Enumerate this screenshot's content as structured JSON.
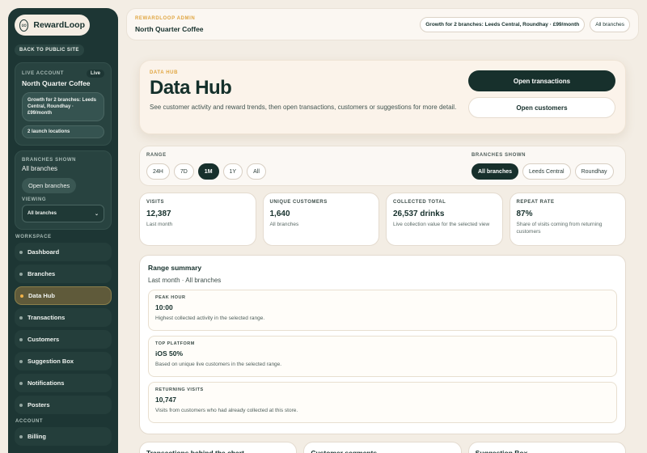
{
  "brand": {
    "name": "RewardLoop",
    "logo_icon": "loop-icon"
  },
  "sidebar": {
    "back_label": "Back to public site",
    "live_account": {
      "eyebrow": "Live account",
      "badge": "Live",
      "name": "North Quarter Coffee",
      "plan": "Growth for 2 branches: Leeds Central, Roundhay · £99/month",
      "locations": "2 launch locations"
    },
    "branches": {
      "eyebrow": "Branches shown",
      "value": "All branches",
      "open_label": "Open branches",
      "viewing_label": "Viewing",
      "viewing_value": "All branches"
    },
    "workspace_label": "Workspace",
    "nav": [
      {
        "label": "Dashboard",
        "active": false
      },
      {
        "label": "Branches",
        "active": false
      },
      {
        "label": "Data Hub",
        "active": true
      },
      {
        "label": "Transactions",
        "active": false
      },
      {
        "label": "Customers",
        "active": false
      },
      {
        "label": "Suggestion Box",
        "active": false
      },
      {
        "label": "Notifications",
        "active": false
      },
      {
        "label": "Posters",
        "active": false
      }
    ],
    "account_label": "Account",
    "account_nav": [
      {
        "label": "Billing"
      }
    ]
  },
  "topbar": {
    "eyebrow": "RewardLoop admin",
    "title": "North Quarter Coffee",
    "plan_pill": "Growth for 2 branches: Leeds Central, Roundhay · £99/month",
    "branch_pill": "All branches"
  },
  "hero": {
    "eyebrow": "Data Hub",
    "title": "Data Hub",
    "description": "See customer activity and reward trends, then open transactions, customers or suggestions for more detail.",
    "primary_button": "Open transactions",
    "secondary_button": "Open customers"
  },
  "filters": {
    "range_label": "Range",
    "ranges": [
      "24H",
      "7D",
      "1M",
      "1Y",
      "All"
    ],
    "active_range": "1M",
    "branches_label": "Branches shown",
    "branches": [
      "All branches",
      "Leeds Central",
      "Roundhay"
    ],
    "active_branch": "All branches"
  },
  "stats": [
    {
      "label": "Visits",
      "value": "12,387",
      "note": "Last month"
    },
    {
      "label": "Unique customers",
      "value": "1,640",
      "note": "All branches"
    },
    {
      "label": "Collected total",
      "value": "26,537 drinks",
      "note": "Live collection value for the selected view"
    },
    {
      "label": "Repeat rate",
      "value": "87%",
      "note": "Share of visits coming from returning customers"
    }
  ],
  "summary": {
    "title": "Range summary",
    "subtitle": "Last month · All branches",
    "items": [
      {
        "label": "Peak hour",
        "value": "10:00",
        "note": "Highest collected activity in the selected range."
      },
      {
        "label": "Top platform",
        "value": "iOS 50%",
        "note": "Based on unique live customers in the selected range."
      },
      {
        "label": "Returning visits",
        "value": "10,747",
        "note": "Visits from customers who had already collected at this store."
      }
    ]
  },
  "bottom_cards": [
    "Transactions behind the chart",
    "Customer segments",
    "Suggestion Box"
  ],
  "colors": {
    "sidebar": "#1d3634",
    "accent": "#e0a642",
    "primary": "#17302c",
    "background": "#f3ede4"
  }
}
